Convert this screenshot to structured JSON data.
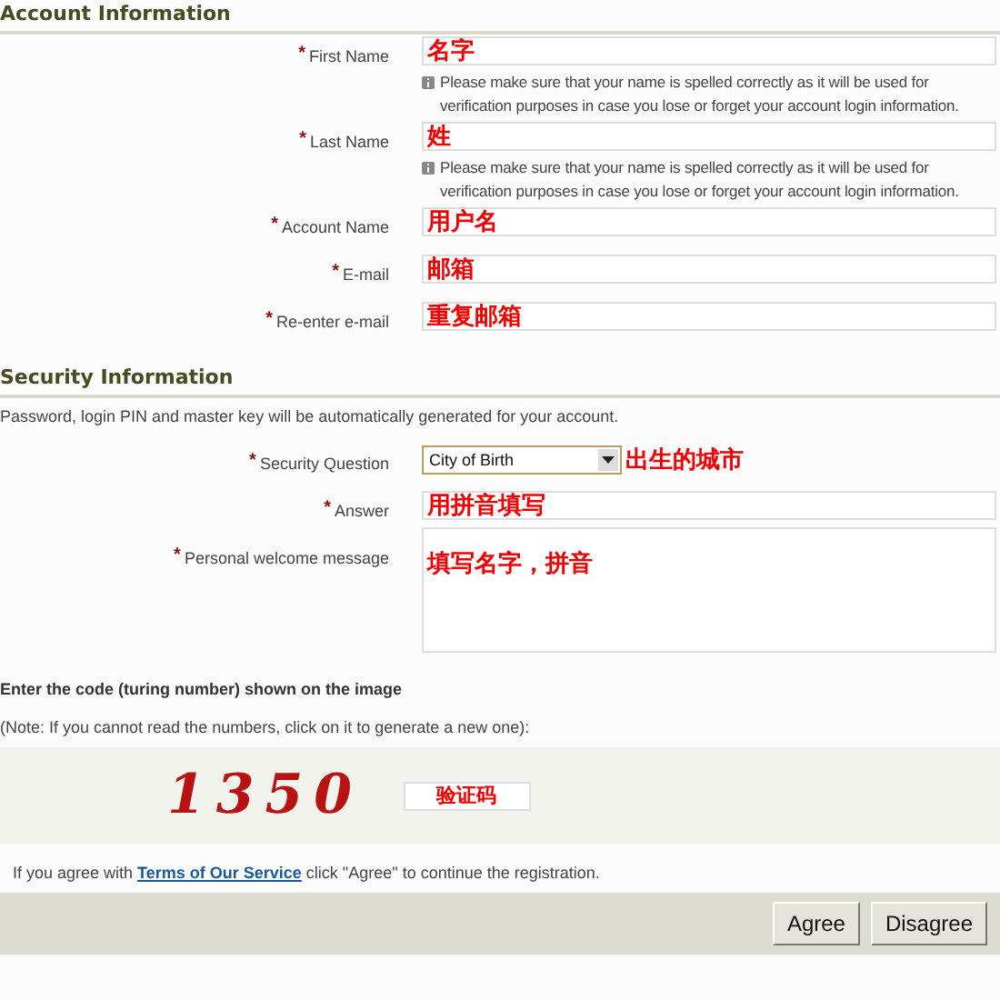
{
  "account": {
    "title": "Account Information",
    "fields": [
      {
        "label": "First Name",
        "mark": "*",
        "value": "名字",
        "hint": "Please make sure that your name is spelled correctly as it will be used for verification purposes in case you lose or forget your account login information."
      },
      {
        "label": "Last Name",
        "mark": "*",
        "value": "姓",
        "hint": "Please make sure that your name is spelled correctly as it will be used for verification purposes in case you lose or forget your account login information."
      },
      {
        "label": "Account Name",
        "mark": "*",
        "value": "用户名"
      },
      {
        "label": "E-mail",
        "mark": "*",
        "value": "邮箱"
      },
      {
        "label": "Re-enter e-mail",
        "mark": "*",
        "value": "重复邮箱"
      }
    ]
  },
  "security": {
    "title": "Security Information",
    "description": "Password, login PIN and master key will be automatically generated for your account.",
    "fields": [
      {
        "kind": "select",
        "label": "Security Question",
        "mark": "*",
        "value": "City of Birth",
        "note": "出生的城市"
      },
      {
        "kind": "text",
        "label": "Answer",
        "mark": "*",
        "value": "用拼音填写"
      },
      {
        "kind": "textarea",
        "label": "Personal welcome message",
        "mark": "*",
        "value": "填写名字，拼音"
      }
    ]
  },
  "captcha": {
    "heading": "Enter the code (turing number) shown on the image",
    "note": "(Note: If you cannot read the numbers, click on it to generate a new one):",
    "code": "1350",
    "value": "验证码"
  },
  "terms": {
    "before": "If you agree with ",
    "link": "Terms of Our Service",
    "after": " click \"Agree\" to continue the registration."
  },
  "buttons": [
    "Agree",
    "Disagree"
  ]
}
